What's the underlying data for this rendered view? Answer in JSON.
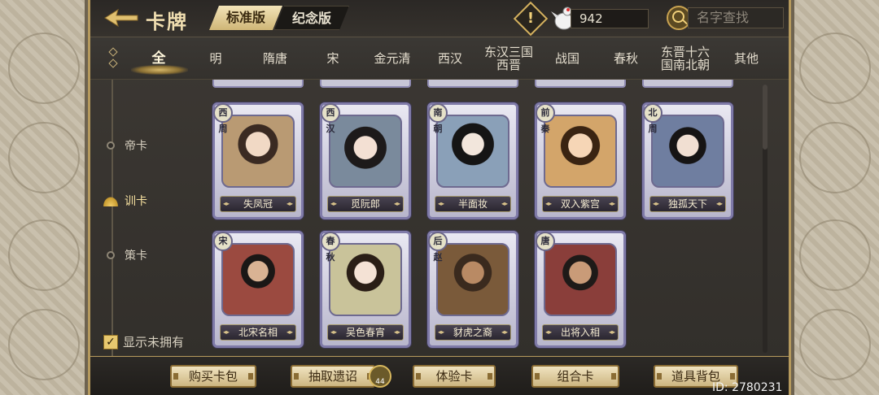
{
  "header": {
    "title": "卡牌",
    "tab_standard": "标准版",
    "tab_memorial": "纪念版",
    "coin_count": "942",
    "search_placeholder": "名字查找"
  },
  "dynasty_tabs": [
    {
      "label": "全",
      "active": true
    },
    {
      "label": "明"
    },
    {
      "label": "隋唐"
    },
    {
      "label": "宋"
    },
    {
      "label": "金元清"
    },
    {
      "label": "西汉"
    },
    {
      "label": "东汉三国\n西晋"
    },
    {
      "label": "战国"
    },
    {
      "label": "春秋"
    },
    {
      "label": "东晋十六\n国南北朝"
    },
    {
      "label": "其他"
    }
  ],
  "left_nav": [
    {
      "label": "帝卡",
      "active": false
    },
    {
      "label": "训卡",
      "active": true
    },
    {
      "label": "策卡",
      "active": false
    }
  ],
  "show_unowned": {
    "label": "显示未拥有",
    "checked": true
  },
  "cards_row1": [
    {
      "name": "失凤冠",
      "badge": "西周",
      "theme": "#b99a73"
    },
    {
      "name": "觅阮郎",
      "badge": "西汉",
      "theme": "#7a8a9c"
    },
    {
      "name": "半面妆",
      "badge": "南朝",
      "theme": "#8aa0b8"
    },
    {
      "name": "双入紫宫",
      "badge": "前秦",
      "theme": "#d3a56a"
    },
    {
      "name": "独孤天下",
      "badge": "北周",
      "theme": "#6f7ea0"
    }
  ],
  "cards_row2": [
    {
      "name": "北宋名相",
      "badge": "宋",
      "theme": "#9b4a40"
    },
    {
      "name": "吴色春宵",
      "badge": "春秋",
      "theme": "#c9c39a"
    },
    {
      "name": "豺虎之裔",
      "badge": "后赵",
      "theme": "#7a5a3a"
    },
    {
      "name": "出将入相",
      "badge": "唐",
      "theme": "#8a3e3a"
    }
  ],
  "bottom_buttons": [
    {
      "label": "购买卡包"
    },
    {
      "label": "抽取遗诏"
    },
    {
      "label": "体验卡"
    },
    {
      "label": "组合卡"
    },
    {
      "label": "道具背包"
    }
  ],
  "scroll_badge_count": "44",
  "user_id": "ID: 2780231"
}
